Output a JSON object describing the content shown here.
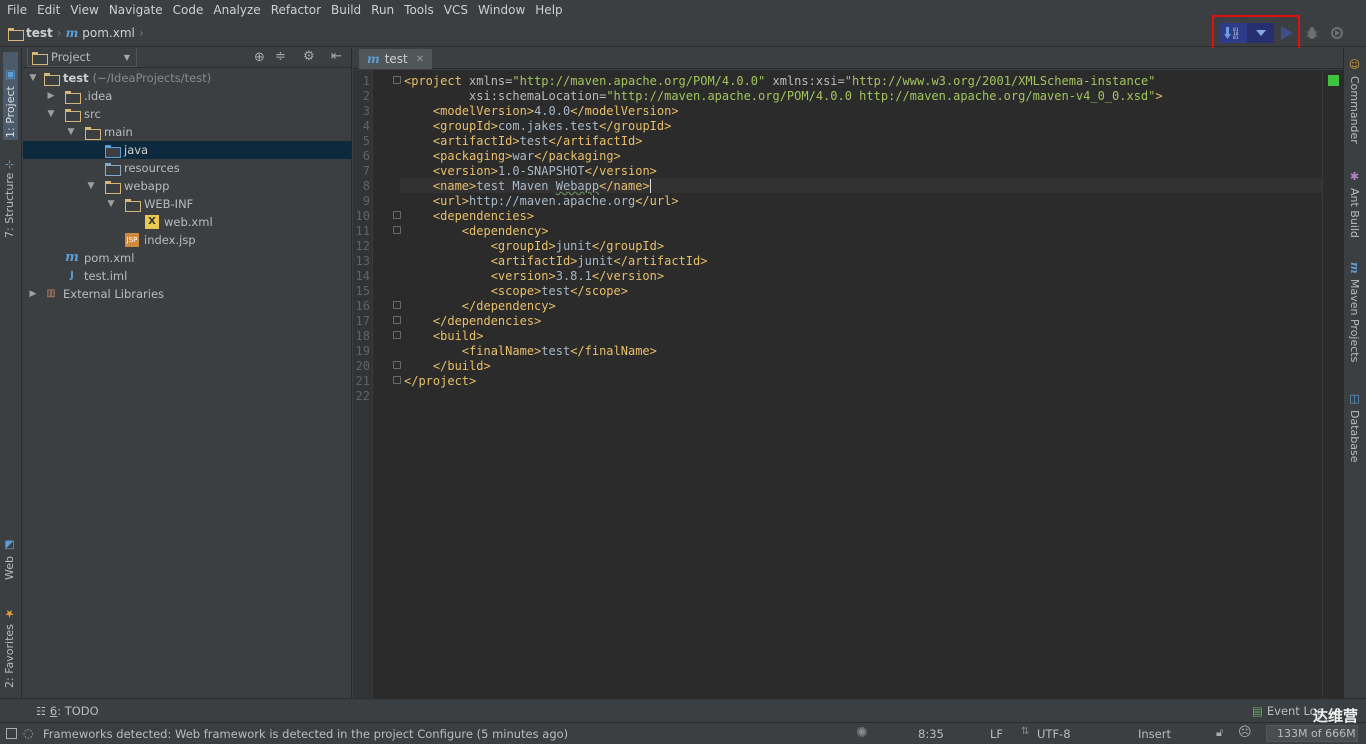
{
  "menu": [
    "File",
    "Edit",
    "View",
    "Navigate",
    "Code",
    "Analyze",
    "Refactor",
    "Build",
    "Run",
    "Tools",
    "VCS",
    "Window",
    "Help"
  ],
  "breadcrumb": {
    "project": "test",
    "file": "pom.xml"
  },
  "left_tabs": {
    "project": "1: Project",
    "structure": "7: Structure",
    "web": "Web",
    "favorites": "2: Favorites"
  },
  "right_tabs": {
    "commander": "Commander",
    "ant": "Ant Build",
    "maven": "Maven Projects",
    "database": "Database"
  },
  "project_panel": {
    "title": "Project",
    "tree": [
      {
        "label": "test",
        "suffix": "(~/IdeaProjects/test)",
        "indent": 0
      },
      {
        "label": ".idea",
        "indent": 1
      },
      {
        "label": "src",
        "indent": 1
      },
      {
        "label": "main",
        "indent": 2
      },
      {
        "label": "java",
        "indent": 3
      },
      {
        "label": "resources",
        "indent": 3
      },
      {
        "label": "webapp",
        "indent": 3
      },
      {
        "label": "WEB-INF",
        "indent": 4
      },
      {
        "label": "web.xml",
        "indent": 5
      },
      {
        "label": "index.jsp",
        "indent": 4
      },
      {
        "label": "pom.xml",
        "indent": 1
      },
      {
        "label": "test.iml",
        "indent": 1
      },
      {
        "label": "External Libraries",
        "indent": 0
      }
    ]
  },
  "editor": {
    "tab": "test",
    "line_numbers": [
      "1",
      "2",
      "3",
      "4",
      "5",
      "6",
      "7",
      "8",
      "9",
      "10",
      "11",
      "12",
      "13",
      "14",
      "15",
      "16",
      "17",
      "18",
      "19",
      "20",
      "21",
      "22"
    ]
  },
  "bottom": {
    "todo_num": "6",
    "todo": ": TODO",
    "event_log": "Event Log",
    "watermark": "达维营"
  },
  "status": {
    "message": "Frameworks detected: Web framework is detected in the project Configure (5 minutes ago)",
    "position": "8:35",
    "line_sep": "LF",
    "encoding": "UTF-8",
    "mode": "Insert",
    "memory": "133M of 666M"
  },
  "colors": {
    "tag": "#e8bf6a",
    "attr_value": "#a5c25c",
    "text": "#a9b7c6",
    "selection": "#0d293e",
    "highlight": "#e01010"
  }
}
